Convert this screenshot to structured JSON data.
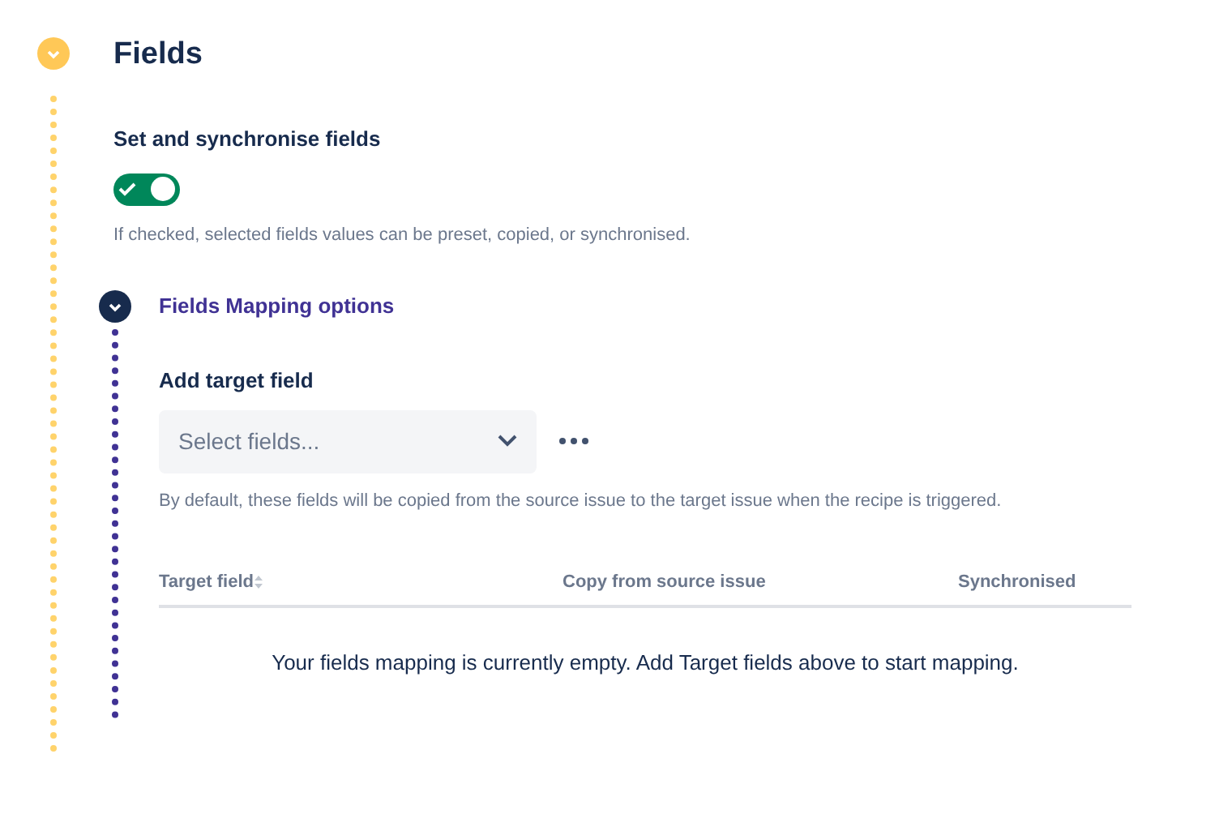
{
  "section": {
    "title": "Fields",
    "expanded": true
  },
  "sync": {
    "label": "Set and synchronise fields",
    "on": true,
    "help": "If checked, selected fields values can be preset, copied, or synchronised."
  },
  "mapping": {
    "title": "Fields Mapping options",
    "expanded": true,
    "target_label": "Add target field",
    "select": {
      "placeholder": "Select fields..."
    },
    "help": "By default, these fields will be copied from the source issue to the target issue when the recipe is triggered.",
    "table": {
      "columns": [
        {
          "label": "Target field",
          "sortable": true
        },
        {
          "label": "Copy from source issue",
          "sortable": false
        },
        {
          "label": "Synchronised",
          "sortable": false
        }
      ],
      "empty": "Your fields mapping is currently empty. Add Target fields above to start mapping."
    }
  }
}
